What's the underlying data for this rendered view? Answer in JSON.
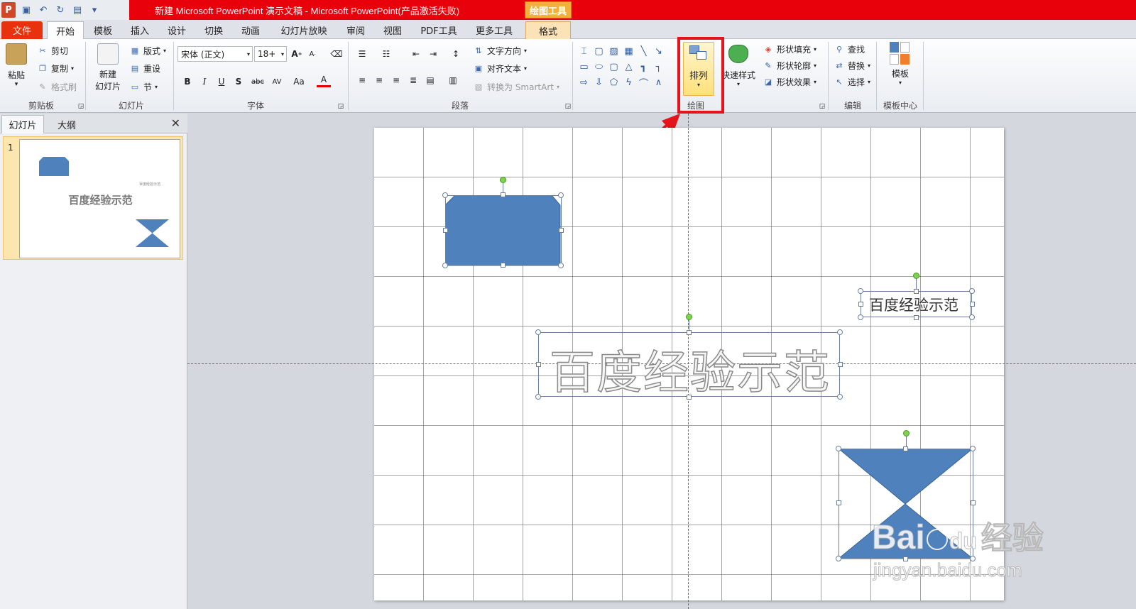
{
  "window": {
    "title": "新建 Microsoft PowerPoint 演示文稿 - Microsoft PowerPoint(产品激活失败)",
    "context_tool": "绘图工具",
    "app_icon_letter": "P"
  },
  "quick_access": {
    "icons": [
      "save-icon",
      "undo-icon",
      "redo-icon",
      "new-slide-icon",
      "customize-icon"
    ]
  },
  "tabs": [
    "文件",
    "开始",
    "模板",
    "插入",
    "设计",
    "切换",
    "动画",
    "幻灯片放映",
    "审阅",
    "视图",
    "PDF工具",
    "更多工具",
    "格式"
  ],
  "active_tab": "开始",
  "ribbon": {
    "clipboard": {
      "paste": "粘贴",
      "cut": "剪切",
      "copy": "复制",
      "format_painter": "格式刷",
      "label": "剪贴板"
    },
    "slides": {
      "new_slide": "新建\n幻灯片",
      "layout": "版式",
      "reset": "重设",
      "section": "节",
      "label": "幻灯片"
    },
    "font": {
      "name": "宋体 (正文)",
      "size": "18+",
      "label": "字体",
      "buttons": [
        "B",
        "I",
        "U",
        "S",
        "abc",
        "AV",
        "Aa",
        "A"
      ]
    },
    "paragraph": {
      "text_direction": "文字方向",
      "align_text": "对齐文本",
      "smartart": "转换为 SmartArt",
      "label": "段落"
    },
    "drawing": {
      "arrange": "排列",
      "quick_styles": "快速样式",
      "shape_fill": "形状填充",
      "shape_outline": "形状轮廓",
      "shape_effects": "形状效果",
      "label": "绘图"
    },
    "editing": {
      "find": "查找",
      "replace": "替换",
      "select": "选择",
      "label": "编辑"
    },
    "template_center": {
      "template": "模板",
      "label": "模板中心"
    }
  },
  "left_pane": {
    "tabs": [
      "幻灯片",
      "大纲"
    ],
    "slide_number": "1",
    "thumb_title": "百度经验示范",
    "thumb_small": "百度经验示范"
  },
  "slide": {
    "title_text": "百度经验示范",
    "small_text": "百度经验示范",
    "shape_color": "#4f81bd"
  },
  "watermark": {
    "brand": "Bai",
    "brand2": "du",
    "brand_cn": "经验",
    "url": "jingyan.baidu.com"
  },
  "colors": {
    "title_bar": "#e8000b",
    "file_tab": "#e8320e",
    "context_tab": "#f0b03a",
    "highlight": "#e4141c"
  }
}
